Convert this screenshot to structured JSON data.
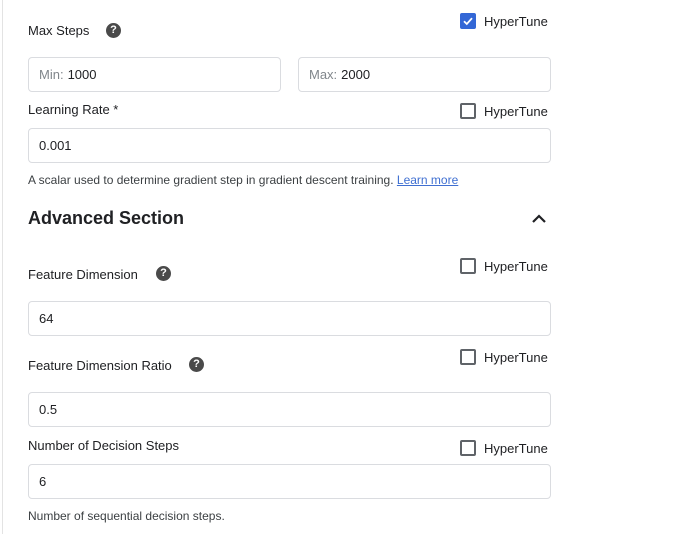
{
  "max_steps": {
    "label": "Max Steps",
    "help_icon": "help-circle-icon",
    "hypertune": {
      "label": "HyperTune",
      "checked": true
    },
    "min": {
      "prefix": "Min:",
      "value": "1000"
    },
    "max": {
      "prefix": "Max:",
      "value": "2000"
    }
  },
  "learning_rate": {
    "label": "Learning Rate *",
    "hypertune": {
      "label": "HyperTune",
      "checked": false
    },
    "value": "0.001",
    "hint": "A scalar used to determine gradient step in gradient descent training.",
    "link": "Learn more"
  },
  "advanced": {
    "title": "Advanced Section",
    "toggle_icon": "chevron-up-icon",
    "expanded": true
  },
  "feature_dimension": {
    "label": "Feature Dimension",
    "help_icon": "help-circle-icon",
    "hypertune": {
      "label": "HyperTune",
      "checked": false
    },
    "value": "64"
  },
  "feature_dimension_ratio": {
    "label": "Feature Dimension Ratio",
    "help_icon": "help-circle-icon",
    "hypertune": {
      "label": "HyperTune",
      "checked": false
    },
    "value": "0.5"
  },
  "decision_steps": {
    "label": "Number of Decision Steps",
    "hypertune": {
      "label": "HyperTune",
      "checked": false
    },
    "value": "6",
    "hint": "Number of sequential decision steps."
  },
  "colors": {
    "accent": "#3367d6",
    "link": "#3f6fd1",
    "border": "#dadce0"
  }
}
